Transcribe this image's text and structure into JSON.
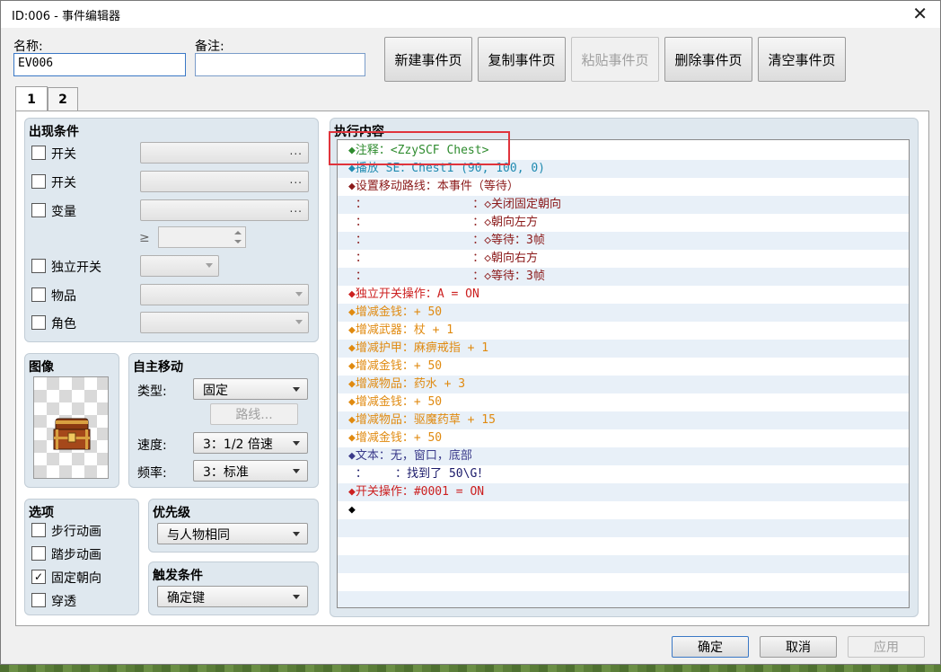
{
  "window": {
    "title": "ID:006 - 事件编辑器",
    "close_glyph": "✕"
  },
  "name_field": {
    "label": "名称:",
    "value": "EV006"
  },
  "note_field": {
    "label": "备注:",
    "value": ""
  },
  "toolbar": {
    "new_page": "新建事件页",
    "copy_page": "复制事件页",
    "paste_page": "粘贴事件页",
    "delete_page": "删除事件页",
    "clear_page": "清空事件页"
  },
  "tabs": [
    "1",
    "2"
  ],
  "conditions": {
    "title": "出现条件",
    "switch1": "开关",
    "switch2": "开关",
    "variable": "变量",
    "gte": "≥",
    "self_switch": "独立开关",
    "item": "物品",
    "actor": "角色",
    "dots": "..."
  },
  "image": {
    "title": "图像"
  },
  "autonomous": {
    "title": "自主移动",
    "type_label": "类型:",
    "type_value": "固定",
    "route_button": "路线...",
    "speed_label": "速度:",
    "speed_value": "3：1/2 倍速",
    "freq_label": "频率:",
    "freq_value": "3：标准"
  },
  "options": {
    "title": "选项",
    "walking": "步行动画",
    "stepping": "踏步动画",
    "direction_fix": "固定朝向",
    "through": "穿透",
    "check": "✓"
  },
  "priority": {
    "title": "优先级",
    "value": "与人物相同"
  },
  "trigger": {
    "title": "触发条件",
    "value": "确定键"
  },
  "contents": {
    "title": "执行内容",
    "commands": [
      {
        "text": "◆注释：<ZzySCF Chest>",
        "color": "#2e8b2e"
      },
      {
        "text": "◆播放 SE：Chest1 (90, 100, 0)",
        "color": "#1f8ab0"
      },
      {
        "text": "◆设置移动路线：本事件（等待）",
        "color": "#8b1a1a"
      },
      {
        "text": " ：               ：◇关闭固定朝向",
        "color": "#8b1a1a"
      },
      {
        "text": " ：               ：◇朝向左方",
        "color": "#8b1a1a"
      },
      {
        "text": " ：               ：◇等待：3帧",
        "color": "#8b1a1a"
      },
      {
        "text": " ：               ：◇朝向右方",
        "color": "#8b1a1a"
      },
      {
        "text": " ：               ：◇等待：3帧",
        "color": "#8b1a1a"
      },
      {
        "text": "◆独立开关操作：A = ON",
        "color": "#cc2020"
      },
      {
        "text": "◆增减金钱：+ 50",
        "color": "#e08a10"
      },
      {
        "text": "◆增减武器：杖 + 1",
        "color": "#e08a10"
      },
      {
        "text": "◆增减护甲：麻痹戒指 + 1",
        "color": "#e08a10"
      },
      {
        "text": "◆增减金钱：+ 50",
        "color": "#e08a10"
      },
      {
        "text": "◆增减物品：药水 + 3",
        "color": "#e08a10"
      },
      {
        "text": "◆增减金钱：+ 50",
        "color": "#e08a10"
      },
      {
        "text": "◆增减物品：驱魔药草 + 15",
        "color": "#e08a10"
      },
      {
        "text": "◆增减金钱：+ 50",
        "color": "#e08a10"
      },
      {
        "text": "◆文本：无，窗口，底部",
        "color": "#3a3a8a"
      },
      {
        "text": " ：    ：找到了 50\\G！",
        "color": "#1a1a6a"
      },
      {
        "text": "◆开关操作：#0001 = ON",
        "color": "#cc2020"
      },
      {
        "text": "◆",
        "color": "#000000"
      }
    ]
  },
  "footer": {
    "ok": "确定",
    "cancel": "取消",
    "apply": "应用"
  }
}
